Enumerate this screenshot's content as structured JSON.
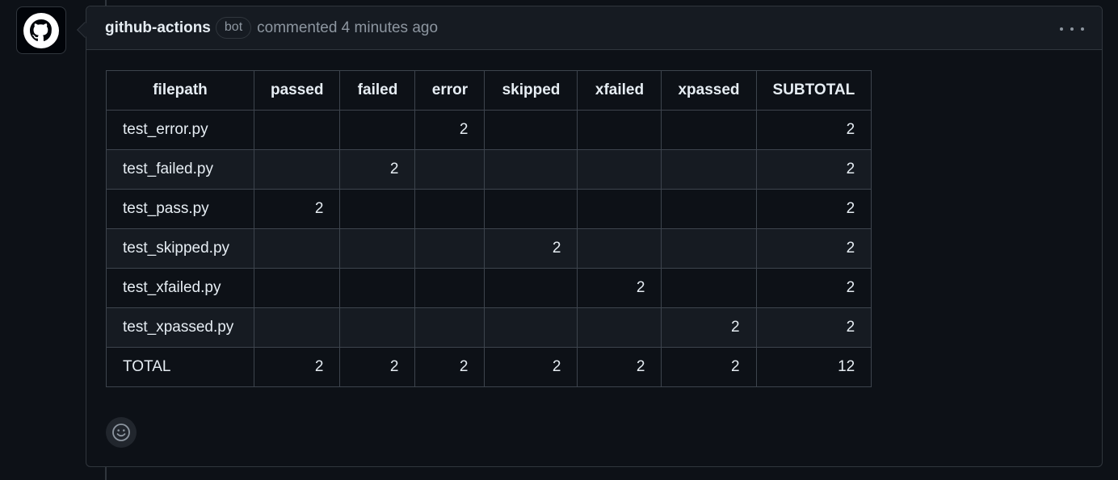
{
  "comment": {
    "author": "github-actions",
    "badge": "bot",
    "meta": "commented 4 minutes ago",
    "avatar_icon": "github-octocat-icon",
    "menu_icon": "kebab-horizontal-icon"
  },
  "table": {
    "headers": [
      "filepath",
      "passed",
      "failed",
      "error",
      "skipped",
      "xfailed",
      "xpassed",
      "SUBTOTAL"
    ],
    "rows": [
      [
        "test_error.py",
        "",
        "",
        "2",
        "",
        "",
        "",
        "2"
      ],
      [
        "test_failed.py",
        "",
        "2",
        "",
        "",
        "",
        "",
        "2"
      ],
      [
        "test_pass.py",
        "2",
        "",
        "",
        "",
        "",
        "",
        "2"
      ],
      [
        "test_skipped.py",
        "",
        "",
        "",
        "2",
        "",
        "",
        "2"
      ],
      [
        "test_xfailed.py",
        "",
        "",
        "",
        "",
        "2",
        "",
        "2"
      ],
      [
        "test_xpassed.py",
        "",
        "",
        "",
        "",
        "",
        "2",
        "2"
      ],
      [
        "TOTAL",
        "2",
        "2",
        "2",
        "2",
        "2",
        "2",
        "12"
      ]
    ]
  },
  "reaction": {
    "icon": "smiley-icon"
  }
}
